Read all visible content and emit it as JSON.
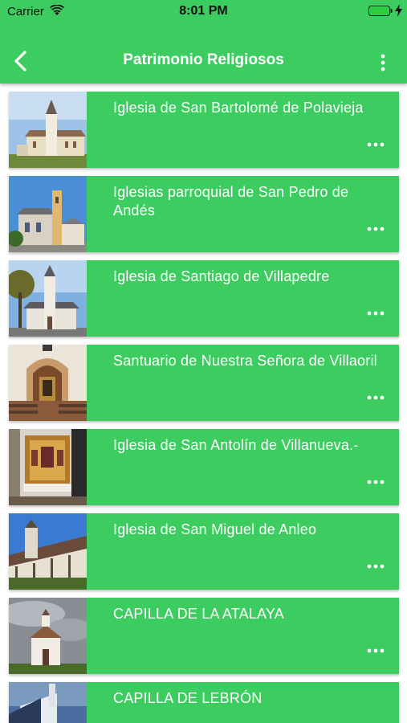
{
  "status": {
    "carrier": "Carrier",
    "time": "8:01 PM"
  },
  "nav": {
    "title": "Patrimonio Religiosos",
    "back_icon": "chevron-left-icon",
    "menu_icon": "more-vertical-icon"
  },
  "colors": {
    "primary": "#3dcc60",
    "text": "#ffffff"
  },
  "items": [
    {
      "title": "Iglesia de San Bartolomé de Polavieja"
    },
    {
      "title": "Iglesias parroquial de San Pedro de Andés"
    },
    {
      "title": "Iglesia de Santiago de Villapedre"
    },
    {
      "title": "Santuario de Nuestra Señora de Villaoril"
    },
    {
      "title": "Iglesia de San Antolín de Villanueva.-"
    },
    {
      "title": "Iglesia de San Miguel de Anleo"
    },
    {
      "title": "CAPILLA DE LA ATALAYA"
    },
    {
      "title": "CAPILLA DE LEBRÓN"
    }
  ]
}
